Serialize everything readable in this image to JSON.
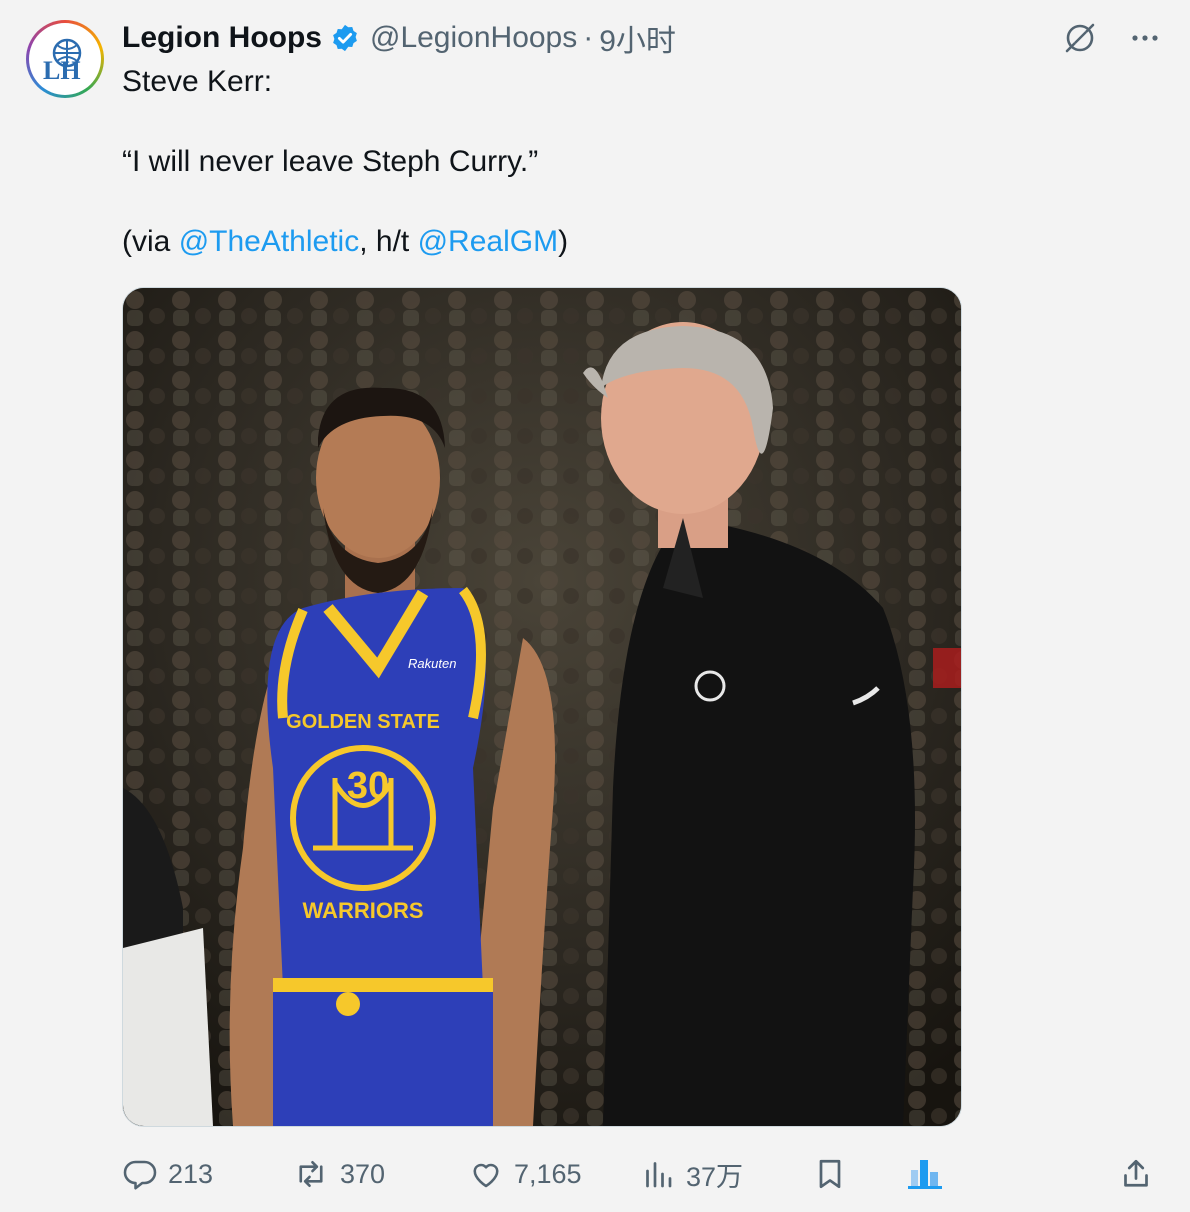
{
  "tweet": {
    "author_name": "Legion Hoops",
    "author_handle": "@LegionHoops",
    "separator": "·",
    "time": "9小时",
    "avatar_text": "LH",
    "line1": "Steve Kerr:",
    "quote": "“I will never leave Steph Curry.”",
    "via_prefix": "(via ",
    "mention1": "@TheAthletic",
    "via_middle": ", h/t ",
    "mention2": "@RealGM",
    "via_suffix": ")",
    "image_jersey_top": "GOLDEN STATE",
    "image_jersey_number": "30",
    "image_jersey_bottom": "WARRIORS",
    "image_sponsor": "Rakuten"
  },
  "actions": {
    "replies": "213",
    "reposts": "370",
    "likes": "7,165",
    "views": "37万"
  },
  "colors": {
    "accent": "#1d9bf0",
    "text_secondary": "#536471",
    "jersey_blue": "#2d3fb8",
    "jersey_gold": "#f6c82b"
  },
  "icons": [
    "verified-badge-icon",
    "grok-icon",
    "more-icon",
    "reply-icon",
    "repost-icon",
    "like-icon",
    "views-icon",
    "bookmark-icon",
    "share-icon"
  ]
}
